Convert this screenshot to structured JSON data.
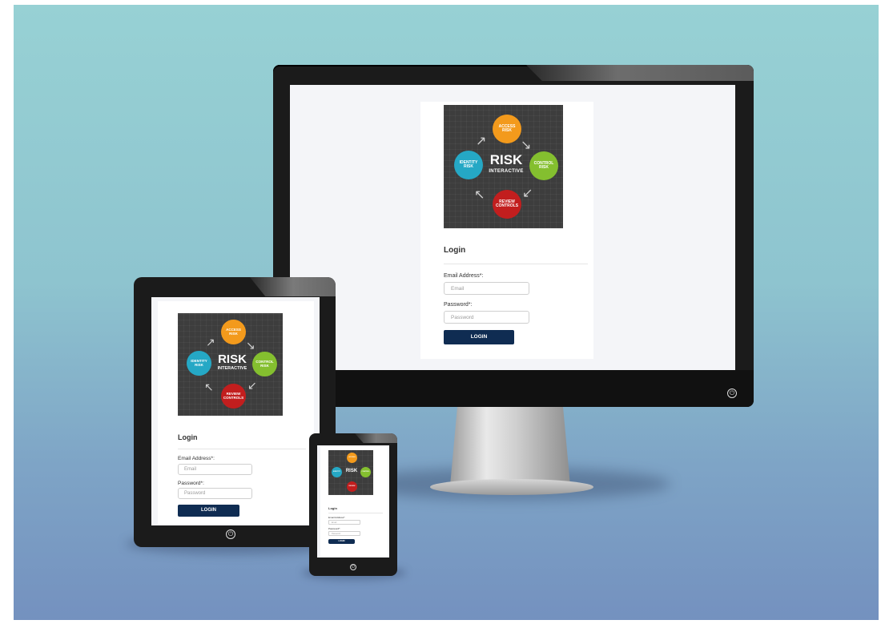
{
  "app": {
    "logo": {
      "center_title": "RISK",
      "center_subtitle": "INTERACTIVE",
      "nodes": [
        {
          "line1": "ACCESS",
          "line2": "RISK",
          "color": "#f39a1c"
        },
        {
          "line1": "IDENTITY",
          "line2": "RISK",
          "color": "#25a8c5"
        },
        {
          "line1": "CONTROL",
          "line2": "RISK",
          "color": "#84bf2f"
        },
        {
          "line1": "REVIEW",
          "line2": "CONTROLS",
          "color": "#c21e1e"
        }
      ]
    },
    "form": {
      "heading": "Login",
      "email_label": "Email Address*:",
      "email_placeholder": "Email",
      "password_label": "Password*:",
      "password_placeholder": "Password",
      "login_button": "LOGIN"
    },
    "colors": {
      "button": "#0f2c52",
      "background_top": "#97d1d4",
      "background_bottom": "#7491bf"
    }
  }
}
